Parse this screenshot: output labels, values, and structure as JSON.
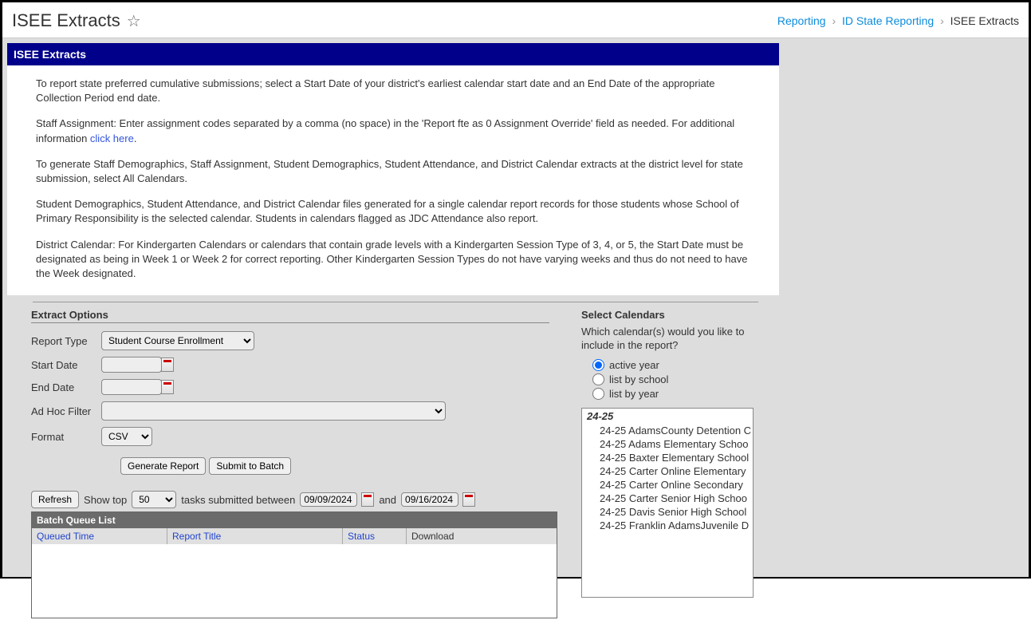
{
  "header": {
    "title": "ISEE Extracts",
    "breadcrumb": {
      "items": [
        "Reporting",
        "ID State Reporting"
      ],
      "current": "ISEE Extracts"
    }
  },
  "section": {
    "title": "ISEE Extracts",
    "para1": "To report state preferred cumulative submissions; select a Start Date of your district's earliest calendar start date and an End Date of the appropriate Collection Period end date.",
    "para2a": "Staff Assignment: Enter assignment codes separated by a comma (no space) in the 'Report fte as 0 Assignment Override' field as needed. For additional information ",
    "para2link": "click here",
    "para2b": ".",
    "para3": "To generate Staff Demographics, Staff Assignment, Student Demographics, Student Attendance, and District Calendar extracts at the district level for state submission, select All Calendars.",
    "para4": "Student Demographics, Student Attendance, and District Calendar files generated for a single calendar report records for those students whose School of Primary Responsibility is the selected calendar. Students in calendars flagged as JDC Attendance also report.",
    "para5": "District Calendar: For Kindergarten Calendars or calendars that contain grade levels with a Kindergarten Session Type of 3, 4, or 5, the Start Date must be designated as being in Week 1 or Week 2 for correct reporting. Other Kindergarten Session Types do not have varying weeks and thus do not need to have the Week designated."
  },
  "extract": {
    "title": "Extract Options",
    "labels": {
      "reportType": "Report Type",
      "startDate": "Start Date",
      "endDate": "End Date",
      "adhoc": "Ad Hoc Filter",
      "format": "Format"
    },
    "reportTypeValue": "Student Course Enrollment",
    "formatValue": "CSV",
    "buttons": {
      "generate": "Generate Report",
      "submit": "Submit to Batch",
      "refresh": "Refresh"
    }
  },
  "queue": {
    "showTopLabel": "Show top",
    "showTopValue": "50",
    "betweenLabel": "tasks submitted between",
    "date1": "09/09/2024",
    "andLabel": "and",
    "date2": "09/16/2024",
    "title": "Batch Queue List",
    "cols": {
      "c1": "Queued Time",
      "c2": "Report Title",
      "c3": "Status",
      "c4": "Download"
    }
  },
  "calendars": {
    "title": "Select Calendars",
    "desc": "Which calendar(s) would you like to include in the report?",
    "radios": {
      "r1": "active year",
      "r2": "list by school",
      "r3": "list by year"
    },
    "groupHeader": "24-25",
    "items": [
      "24-25 AdamsCounty Detention C",
      "24-25 Adams Elementary Schoo",
      "24-25 Baxter Elementary School",
      "24-25 Carter Online Elementary",
      "24-25 Carter Online Secondary",
      "24-25 Carter Senior High Schoo",
      "24-25 Davis Senior High School",
      "24-25 Franklin AdamsJuvenile D"
    ]
  }
}
